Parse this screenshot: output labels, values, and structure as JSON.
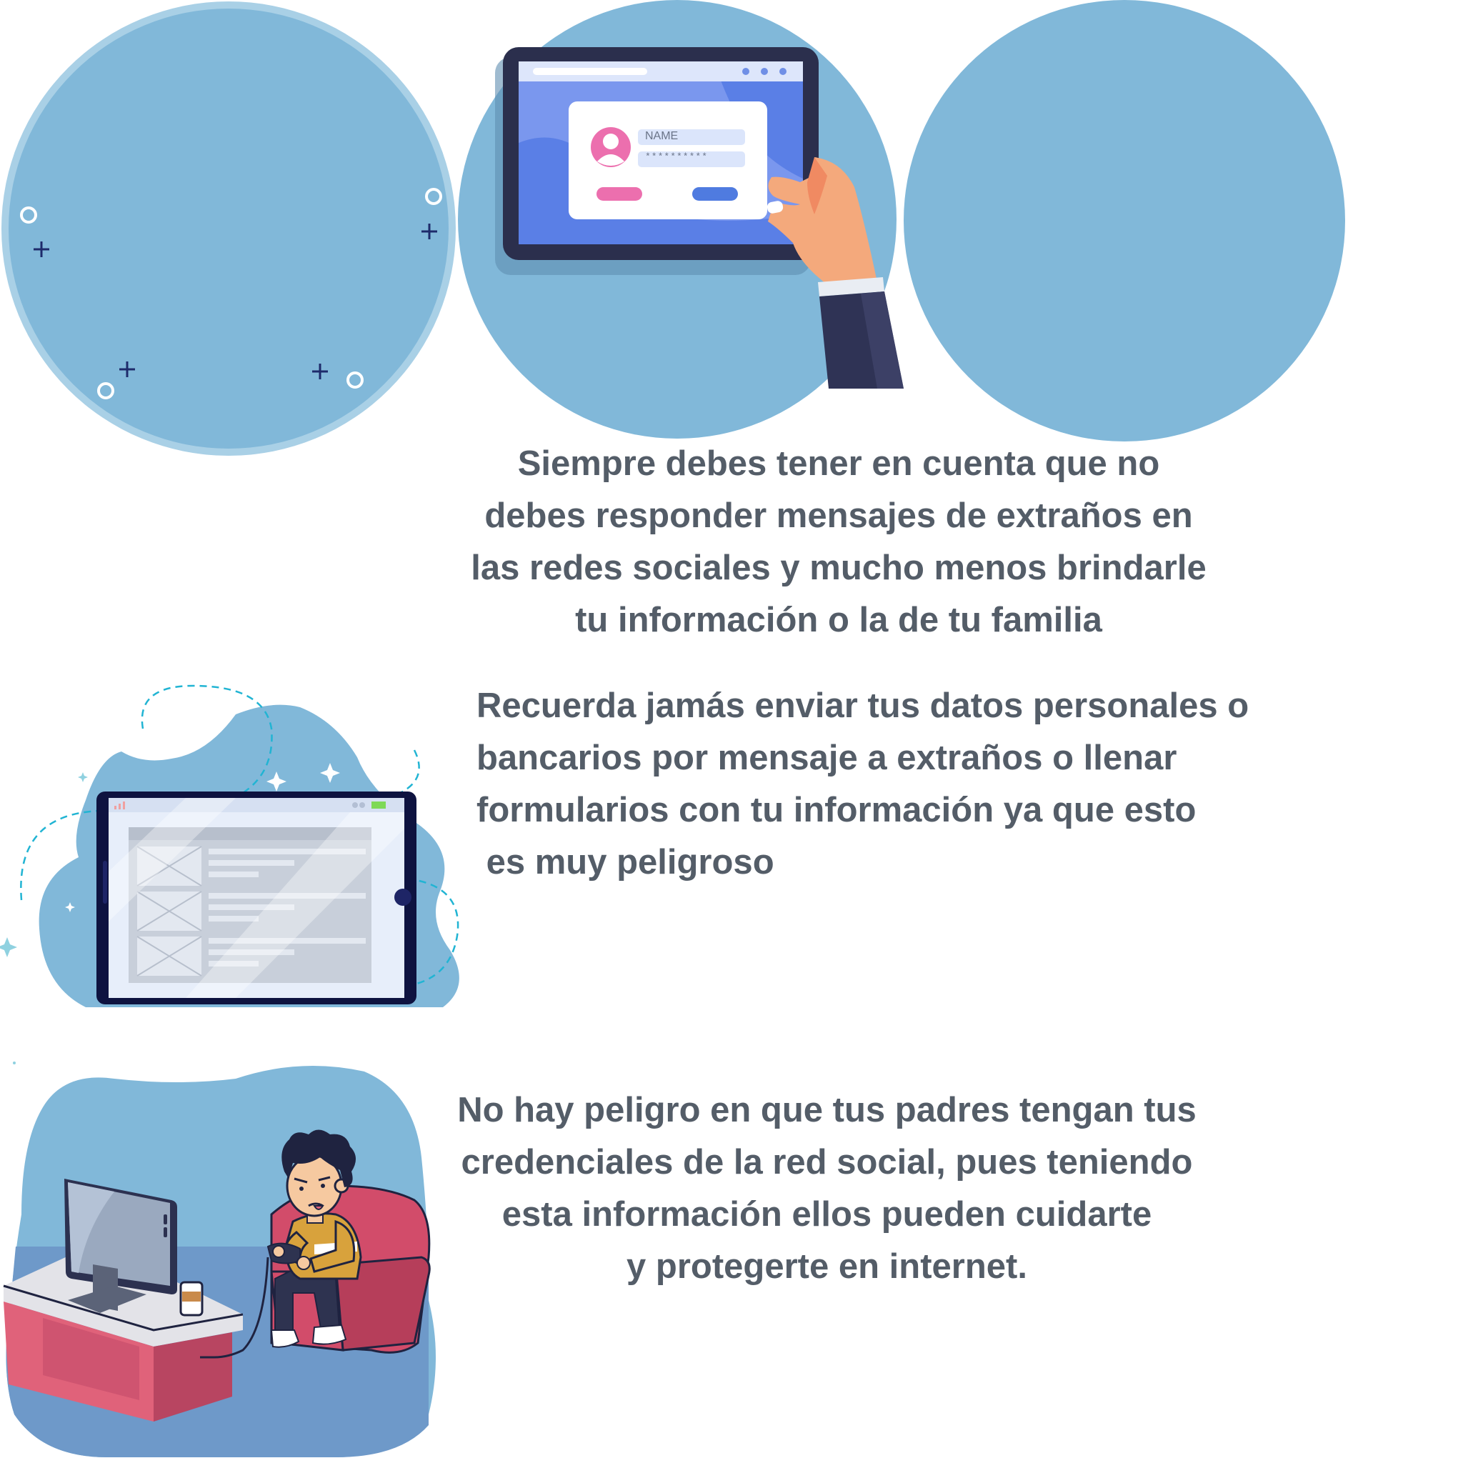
{
  "illustrations": {
    "tablet_login": {
      "name_field_label": "NAME",
      "password_field_value": "**********"
    }
  },
  "paragraphs": [
    {
      "lines": [
        "Siempre debes tener en cuenta que no",
        "debes responder mensajes de extraños en",
        "las redes sociales y mucho menos brindarle",
        "tu información o la de tu familia"
      ]
    },
    {
      "lines": [
        "Recuerda jamás enviar tus datos personales o",
        "bancarios por mensaje a extraños o llenar",
        "formularios con tu información ya que esto",
        " es muy peligroso"
      ]
    },
    {
      "lines": [
        "No hay peligro en que tus padres tengan tus",
        "credenciales de la red social, pues teniendo",
        "esta información ellos pueden cuidarte",
        "y protegerte en internet."
      ]
    }
  ],
  "colors": {
    "text": "#545d68",
    "circle_blue": "#81b8d9",
    "circle_ring": "#a9d0e6",
    "tablet_frame": "#2b2f4d",
    "accent_pink": "#ec6fae",
    "accent_blue": "#4f7be0"
  }
}
